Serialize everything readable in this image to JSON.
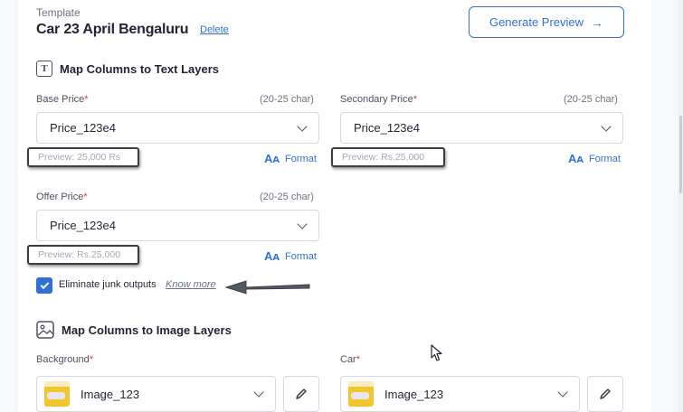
{
  "template": {
    "label": "Template",
    "name": "Car 23 April Bengaluru",
    "delete_label": "Delete"
  },
  "actions": {
    "generate_preview_label": "Generate Preview",
    "generate_preview_arrow": "→"
  },
  "text_layers": {
    "title": "Map Columns to Text Layers",
    "icon": "text-layer-icon",
    "icon_glyph": "T",
    "fields": [
      {
        "label": "Base Price",
        "required": "*",
        "hint": "(20-25 char)",
        "value": "Price_123e4",
        "preview": "Preview: 25,000 Rs",
        "format_label": "Format"
      },
      {
        "label": "Secondary Price",
        "required": "*",
        "hint": "(20-25 char)",
        "value": "Price_123e4",
        "preview": "Preview: Rs.25,000",
        "format_label": "Format"
      },
      {
        "label": "Offer Price",
        "required": "*",
        "hint": "(20-25 char)",
        "value": "Price_123e4",
        "preview": "Preview: Rs.25,000",
        "format_label": "Format"
      }
    ],
    "format_icon_glyph": "Aᴀ",
    "eliminate_junk": {
      "checked": true,
      "label": "Eliminate junk outputs",
      "know_more": "Know more"
    }
  },
  "image_layers": {
    "title": "Map Columns to Image Layers",
    "icon": "image-layer-icon",
    "fields": [
      {
        "label": "Background",
        "required": "*",
        "value": "Image_123"
      },
      {
        "label": "Car",
        "required": "*",
        "value": "Image_123"
      }
    ]
  },
  "colors": {
    "accent": "#2f6fd6",
    "required": "#d93a3a",
    "checkbox": "#2f6fd6"
  }
}
